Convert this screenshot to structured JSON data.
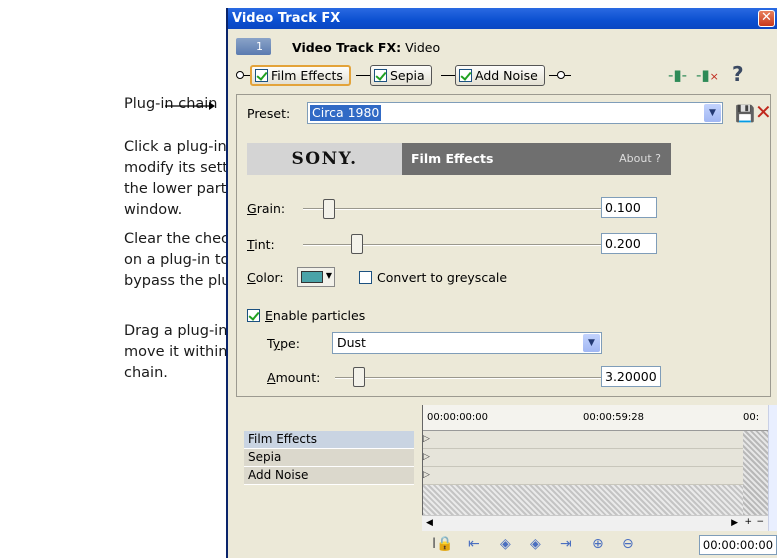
{
  "annotations": {
    "chain_label": "Plug-in chain",
    "note_click": "Click a plug-in to modify its settings in the lower part of the window.",
    "note_clear": "Clear the check box on a plug-in to bypass the plug-in.",
    "note_drag": "Drag a plug-in to move it within the chain."
  },
  "window": {
    "title": "Video Track FX",
    "close_glyph": "✕",
    "track_number": "1",
    "track_title_bold": "Video Track FX:",
    "track_title_rest": " Video"
  },
  "chain": {
    "plugins": [
      {
        "label": "Film Effects",
        "checked": true,
        "active": true
      },
      {
        "label": "Sepia",
        "checked": true,
        "active": false
      },
      {
        "label": "Add Noise",
        "checked": true,
        "active": false
      }
    ],
    "help_glyph": "?"
  },
  "preset": {
    "label": "Preset:",
    "value": "Circa 1980"
  },
  "plugin_header": {
    "brand": "SONY.",
    "name": "Film Effects",
    "about": "About  ?"
  },
  "controls": {
    "grain": {
      "label_u": "G",
      "label_rest": "rain:",
      "value": "0.100"
    },
    "tint": {
      "label_u": "T",
      "label_rest": "int:",
      "value": "0.200"
    },
    "color": {
      "label_u": "C",
      "label_rest": "olor:",
      "swatch": "#4aa3a8"
    },
    "greyscale": {
      "label": "Convert to greyscale",
      "checked": false
    },
    "particles": {
      "label_u": "E",
      "label_rest": "nable particles",
      "checked": true
    },
    "type": {
      "label_pre": "T",
      "label_u": "y",
      "label_rest": "pe:",
      "value": "Dust"
    },
    "amount": {
      "label_u": "A",
      "label_rest": "mount:",
      "value": "3.20000"
    }
  },
  "timeline": {
    "ruler": [
      "00:00:00:00",
      "00:00:59:28",
      "00:"
    ],
    "tracks": [
      "Film Effects",
      "Sepia",
      "Add Noise"
    ],
    "timecode": "00:00:00:00"
  }
}
